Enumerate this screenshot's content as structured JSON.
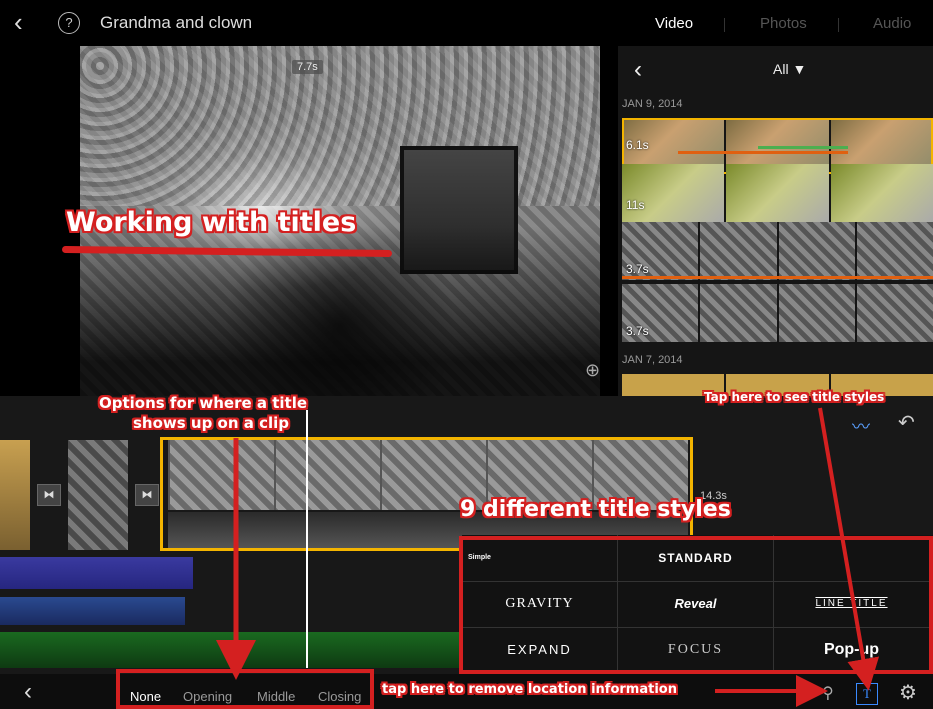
{
  "header": {
    "back_glyph": "‹",
    "help_glyph": "?",
    "project_title": "Grandma and clown",
    "tabs": [
      "Video",
      "Photos",
      "Audio"
    ]
  },
  "viewer": {
    "duration_badge": "7.7s"
  },
  "browser": {
    "filter_label": "All ▼",
    "date_1": "JAN 9, 2014",
    "date_2": "JAN 7, 2014",
    "clip_durations": [
      "6.1s",
      "11s",
      "3.7s",
      "3.7s"
    ]
  },
  "timeline": {
    "clip_duration": "14.3s",
    "transition_glyph": "⧓"
  },
  "title_styles": {
    "cells": [
      "Simple",
      "STANDARD",
      "",
      "GRAVITY",
      "Reveal",
      "LINE TITLE",
      "EXPAND",
      "FOCUS",
      "Pop-up"
    ]
  },
  "bottom_bar": {
    "options": [
      "None",
      "Opening",
      "Middle",
      "Closing"
    ]
  },
  "annotations": {
    "working": "Working with titles",
    "options_line1": "Options for where a title",
    "options_line2": "shows up on a clip",
    "tap_styles": "Tap here to see title styles",
    "nine_styles": "9 different title styles",
    "tap_remove": "tap here to remove location information"
  },
  "colors": {
    "selection": "#f3b400",
    "annotation_red": "#d42020",
    "accent_blue": "#3a8aff"
  }
}
